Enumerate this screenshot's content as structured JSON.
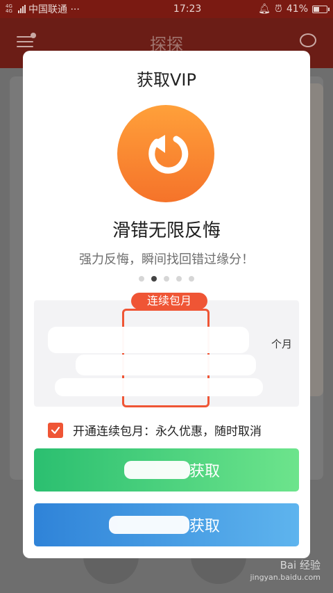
{
  "status_bar": {
    "network": "4G 4G",
    "carrier": "中国联通 ···",
    "time": "17:23",
    "battery": "41%",
    "battery_level": 0.41
  },
  "app_bar": {
    "title": "探探"
  },
  "dialog": {
    "title": "获取VIP",
    "feature_title": "滑错无限反悔",
    "feature_subtitle": "强力反悔，瞬间找回错过缘分！",
    "carousel": {
      "total": 5,
      "active_index": 1
    },
    "plan_badge": "连续包月",
    "plan_right_fragment": "个月",
    "auto_renew": {
      "checked": true,
      "label": "开通连续包月：永久优惠，随时取消"
    },
    "buttons": {
      "primary_visible": "获取",
      "secondary_visible": "获取"
    }
  },
  "watermark": {
    "main": "Bai 经验",
    "sub": "jingyan.baidu.com"
  },
  "colors": {
    "accent": "#ef5535",
    "hero_orange": "#f5732a",
    "button_green": "#2bbf70",
    "button_blue": "#2f83d8",
    "status_bar_bg": "#7a1a12"
  }
}
